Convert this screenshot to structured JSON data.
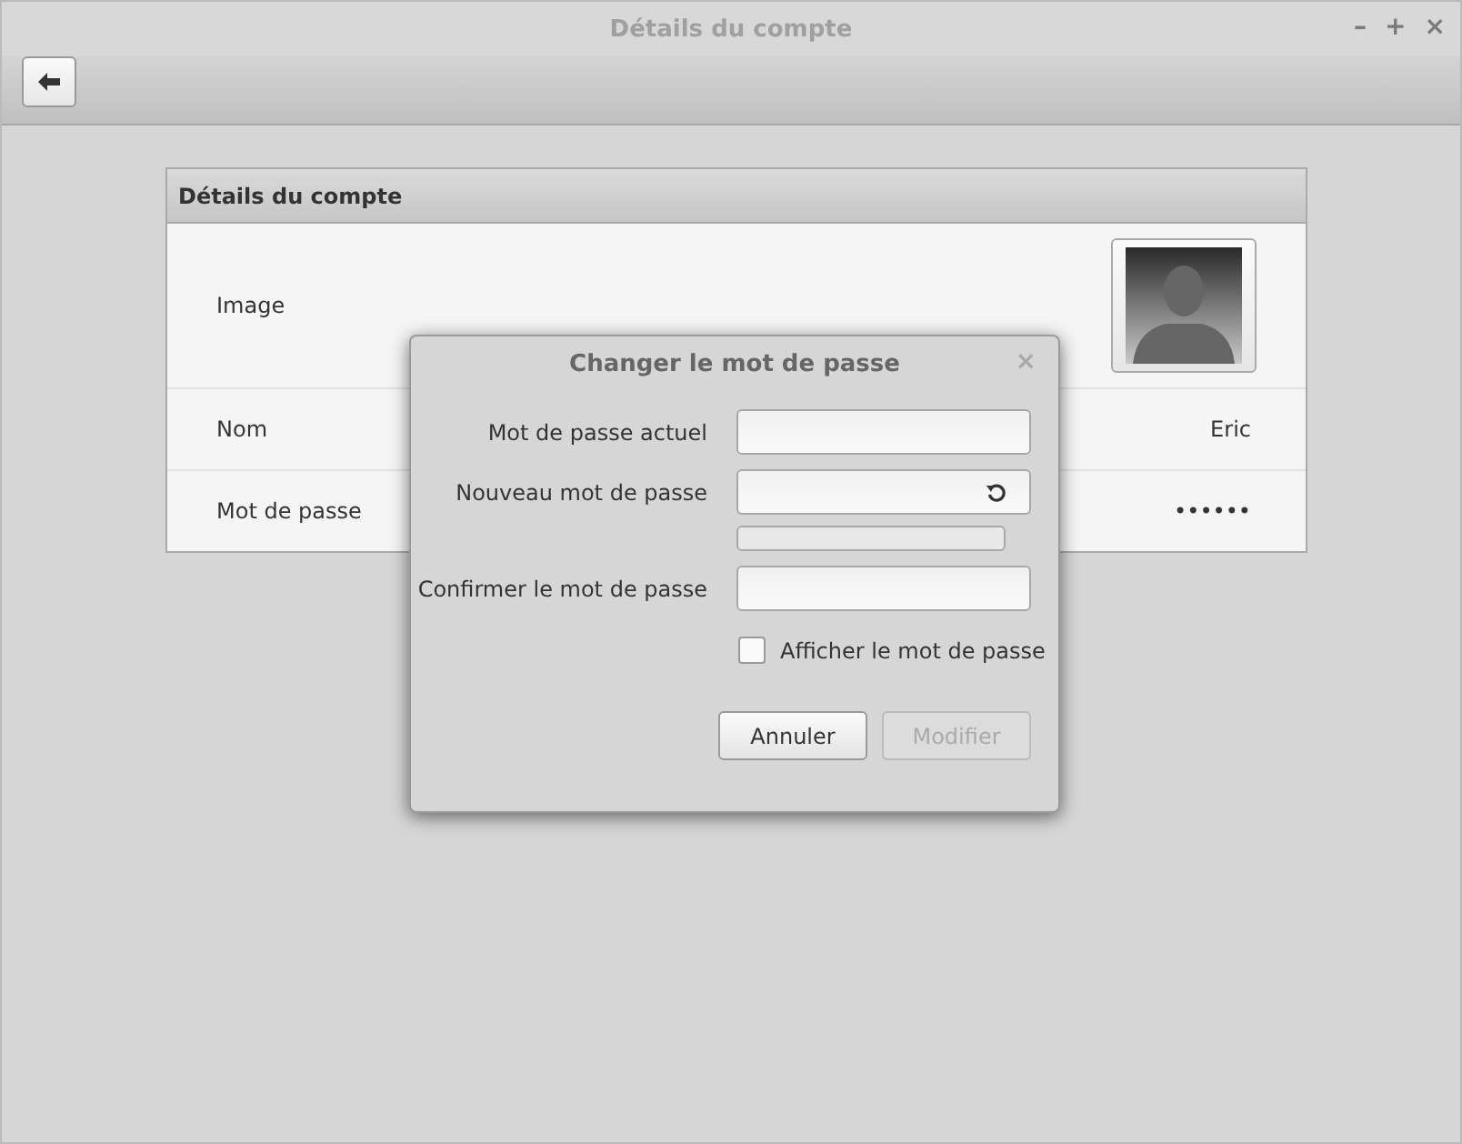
{
  "window": {
    "title": "Détails du compte",
    "controls": [
      "–",
      "+",
      "×"
    ]
  },
  "panel": {
    "title": "Détails du compte",
    "rows": [
      {
        "kind": "image",
        "label": "Image"
      },
      {
        "kind": "text",
        "label": "Nom",
        "value": "Eric"
      },
      {
        "kind": "text",
        "label": "Mot de passe",
        "value": "••••••"
      }
    ]
  },
  "dialog": {
    "title": "Changer le mot de passe",
    "close": "×",
    "fields": [
      {
        "kind": "entry",
        "label": "Mot de passe actuel"
      },
      {
        "kind": "generate",
        "label": "Nouveau mot de passe"
      },
      {
        "kind": "strength",
        "level": 0
      },
      {
        "kind": "entry",
        "label": "Confirmer le mot de passe"
      }
    ],
    "show_password": {
      "label": "Afficher le mot de passe",
      "checked": false
    },
    "buttons": [
      {
        "label": "Annuler",
        "disabled": false
      },
      {
        "label": "Modifier",
        "disabled": true
      }
    ]
  }
}
